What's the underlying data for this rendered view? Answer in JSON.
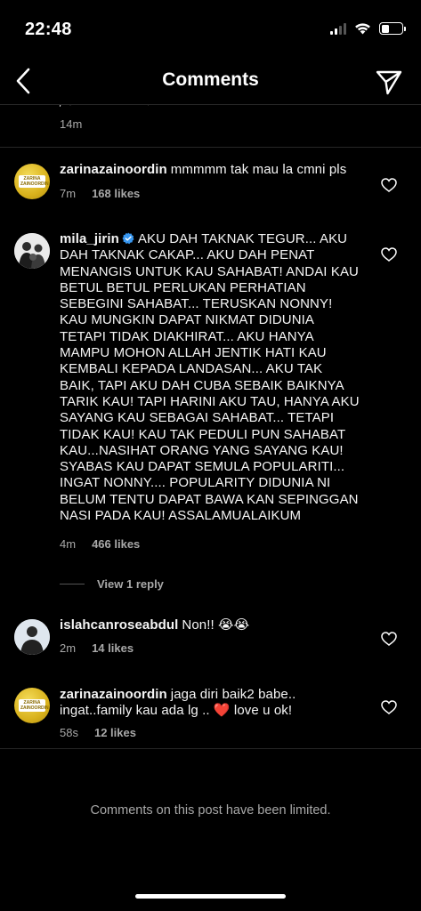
{
  "status_bar": {
    "time": "22:48",
    "icons": [
      "cellular-signal-icon",
      "wifi-icon",
      "battery-icon"
    ]
  },
  "nav": {
    "title": "Comments",
    "back_icon": "back-arrow-icon",
    "send_icon": "send-icon"
  },
  "partial_comment": {
    "time": "14m"
  },
  "comments": [
    {
      "username": "zarinazainoordin",
      "avatar_text": "ZARINA ZAINOORDIN",
      "text": "mmmmm tak mau la cmni pls",
      "time": "7m",
      "likes": "168 likes"
    },
    {
      "username": "mila_jirin",
      "verified": true,
      "text": "AKU DAH TAKNAK TEGUR... AKU DAH TAKNAK CAKAP... AKU DAH PENAT MENANGIS UNTUK KAU SAHABAT! ANDAI KAU BETUL BETUL PERLUKAN PERHATIAN SEBEGINI SAHABAT... TERUSKAN NONNY! KAU MUNGKIN DAPAT NIKMAT DIDUNIA TETAPI TIDAK DIAKHIRAT... AKU HANYA MAMPU MOHON ALLAH JENTIK HATI KAU KEMBALI KEPADA LANDASAN... AKU TAK BAIK, TAPI AKU DAH CUBA SEBAIK BAIKNYA TARIK KAU! TAPI HARINI AKU TAU, HANYA AKU SAYANG KAU SEBAGAI SAHABAT... TETAPI TIDAK KAU! KAU TAK PEDULI PUN SAHABAT KAU...NASIHAT ORANG YANG SAYANG KAU! SYABAS KAU DAPAT SEMULA POPULARITI... INGAT NONNY.... POPULARITY DIDUNIA NI BELUM TENTU DAPAT BAWA KAN SEPINGGAN NASI PADA KAU! ASSALAMUALAIKUM",
      "time": "4m",
      "likes": "466 likes",
      "view_replies": "View 1 reply"
    },
    {
      "username": "islahcanroseabdul",
      "text": "Non!! 😭😭",
      "time": "2m",
      "likes": "14 likes"
    },
    {
      "username": "zarinazainoordin",
      "avatar_text": "ZARINA ZAINOORDIN",
      "text": "jaga diri baik2 babe.. ingat..family kau ada lg .. ❤️ love u ok!",
      "time": "58s",
      "likes": "12 likes"
    }
  ],
  "footer": {
    "limited_notice": "Comments on this post have been limited."
  },
  "colors": {
    "background": "#000000",
    "text_primary": "#f5f5f5",
    "text_secondary": "#a8a8a8",
    "divider": "#262626",
    "verified_blue": "#3897f0",
    "heart_red": "#ed4956"
  }
}
